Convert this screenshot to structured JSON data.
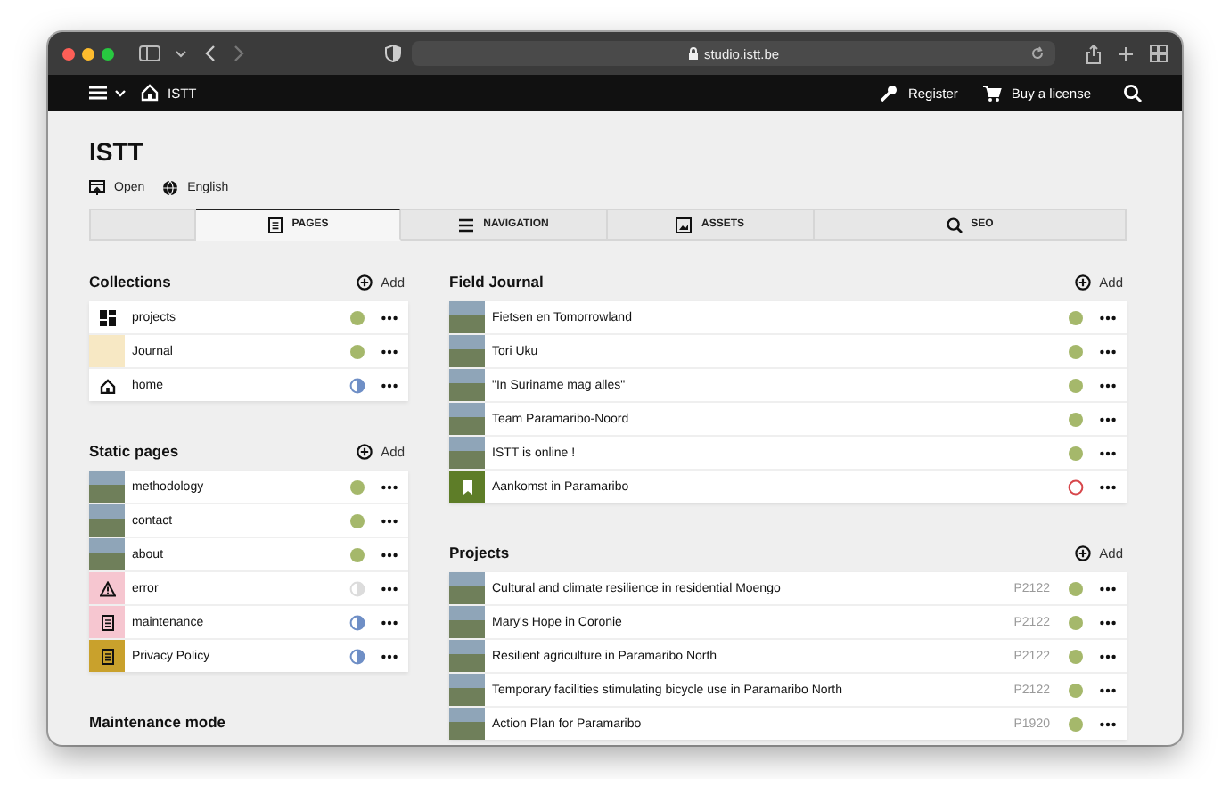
{
  "browser": {
    "url": "studio.istt.be"
  },
  "topbar": {
    "home_label": "ISTT",
    "register": "Register",
    "license": "Buy a license"
  },
  "site": {
    "title": "ISTT",
    "open": "Open",
    "language": "English"
  },
  "tabs": [
    {
      "label": "PAGES",
      "kind": "pages",
      "selected": true
    },
    {
      "label": "NAVIGATION",
      "kind": "navigation",
      "selected": false
    },
    {
      "label": "ASSETS",
      "kind": "assets",
      "selected": false
    },
    {
      "label": "SEO",
      "kind": "seo",
      "selected": false
    }
  ],
  "left": [
    {
      "title": "Collections",
      "add": "Add",
      "rows": [
        {
          "title": "projects",
          "thumb": {
            "kind": "grid"
          },
          "status": {
            "kind": "listed"
          }
        },
        {
          "title": "Journal",
          "thumb": {
            "kind": "swatch",
            "color": "#f7e8c4"
          },
          "status": {
            "kind": "listed"
          }
        },
        {
          "title": "home",
          "thumb": {
            "kind": "home"
          },
          "status": {
            "kind": "unlisted"
          }
        }
      ]
    },
    {
      "title": "Static pages",
      "add": "Add",
      "rows": [
        {
          "title": "methodology",
          "thumb": {
            "kind": "photo"
          },
          "status": {
            "kind": "listed"
          }
        },
        {
          "title": "contact",
          "thumb": {
            "kind": "photo"
          },
          "status": {
            "kind": "listed"
          }
        },
        {
          "title": "about",
          "thumb": {
            "kind": "photo"
          },
          "status": {
            "kind": "listed"
          }
        },
        {
          "title": "error",
          "thumb": {
            "kind": "warning",
            "color": "#f6c6d0"
          },
          "status": {
            "kind": "inactive"
          }
        },
        {
          "title": "maintenance",
          "thumb": {
            "kind": "page",
            "color": "#f6c6d0"
          },
          "status": {
            "kind": "unlisted"
          }
        },
        {
          "title": "Privacy Policy",
          "thumb": {
            "kind": "page",
            "color": "#c9a12c"
          },
          "status": {
            "kind": "unlisted"
          }
        }
      ]
    },
    {
      "title": "Maintenance mode"
    }
  ],
  "right": [
    {
      "title": "Field Journal",
      "add": "Add",
      "rows": [
        {
          "title": "Fietsen en Tomorrowland",
          "thumb": {
            "kind": "photo"
          },
          "status": {
            "kind": "listed"
          }
        },
        {
          "title": "Tori Uku",
          "thumb": {
            "kind": "photo"
          },
          "status": {
            "kind": "listed"
          }
        },
        {
          "title": "\"In Suriname mag alles\"",
          "thumb": {
            "kind": "photo"
          },
          "status": {
            "kind": "listed"
          }
        },
        {
          "title": "Team Paramaribo-Noord",
          "thumb": {
            "kind": "photo"
          },
          "status": {
            "kind": "listed"
          }
        },
        {
          "title": "ISTT is online !",
          "thumb": {
            "kind": "photo"
          },
          "status": {
            "kind": "listed"
          }
        },
        {
          "title": "Aankomst in Paramaribo",
          "thumb": {
            "kind": "bookmark",
            "color": "#5e7d28"
          },
          "status": {
            "kind": "draft"
          }
        }
      ]
    },
    {
      "title": "Projects",
      "add": "Add",
      "rows": [
        {
          "title": "Cultural and climate resilience in residential Moengo",
          "code": "P2122",
          "thumb": {
            "kind": "photo"
          },
          "status": {
            "kind": "listed"
          }
        },
        {
          "title": "Mary's Hope in Coronie",
          "code": "P2122",
          "thumb": {
            "kind": "photo"
          },
          "status": {
            "kind": "listed"
          }
        },
        {
          "title": "Resilient agriculture in Paramaribo North",
          "code": "P2122",
          "thumb": {
            "kind": "photo"
          },
          "status": {
            "kind": "listed"
          }
        },
        {
          "title": "Temporary facilities stimulating bicycle use in Paramaribo North",
          "code": "P2122",
          "thumb": {
            "kind": "photo"
          },
          "status": {
            "kind": "listed"
          }
        },
        {
          "title": "Action Plan for Paramaribo",
          "code": "P1920",
          "thumb": {
            "kind": "photo"
          },
          "status": {
            "kind": "listed"
          }
        }
      ]
    }
  ]
}
